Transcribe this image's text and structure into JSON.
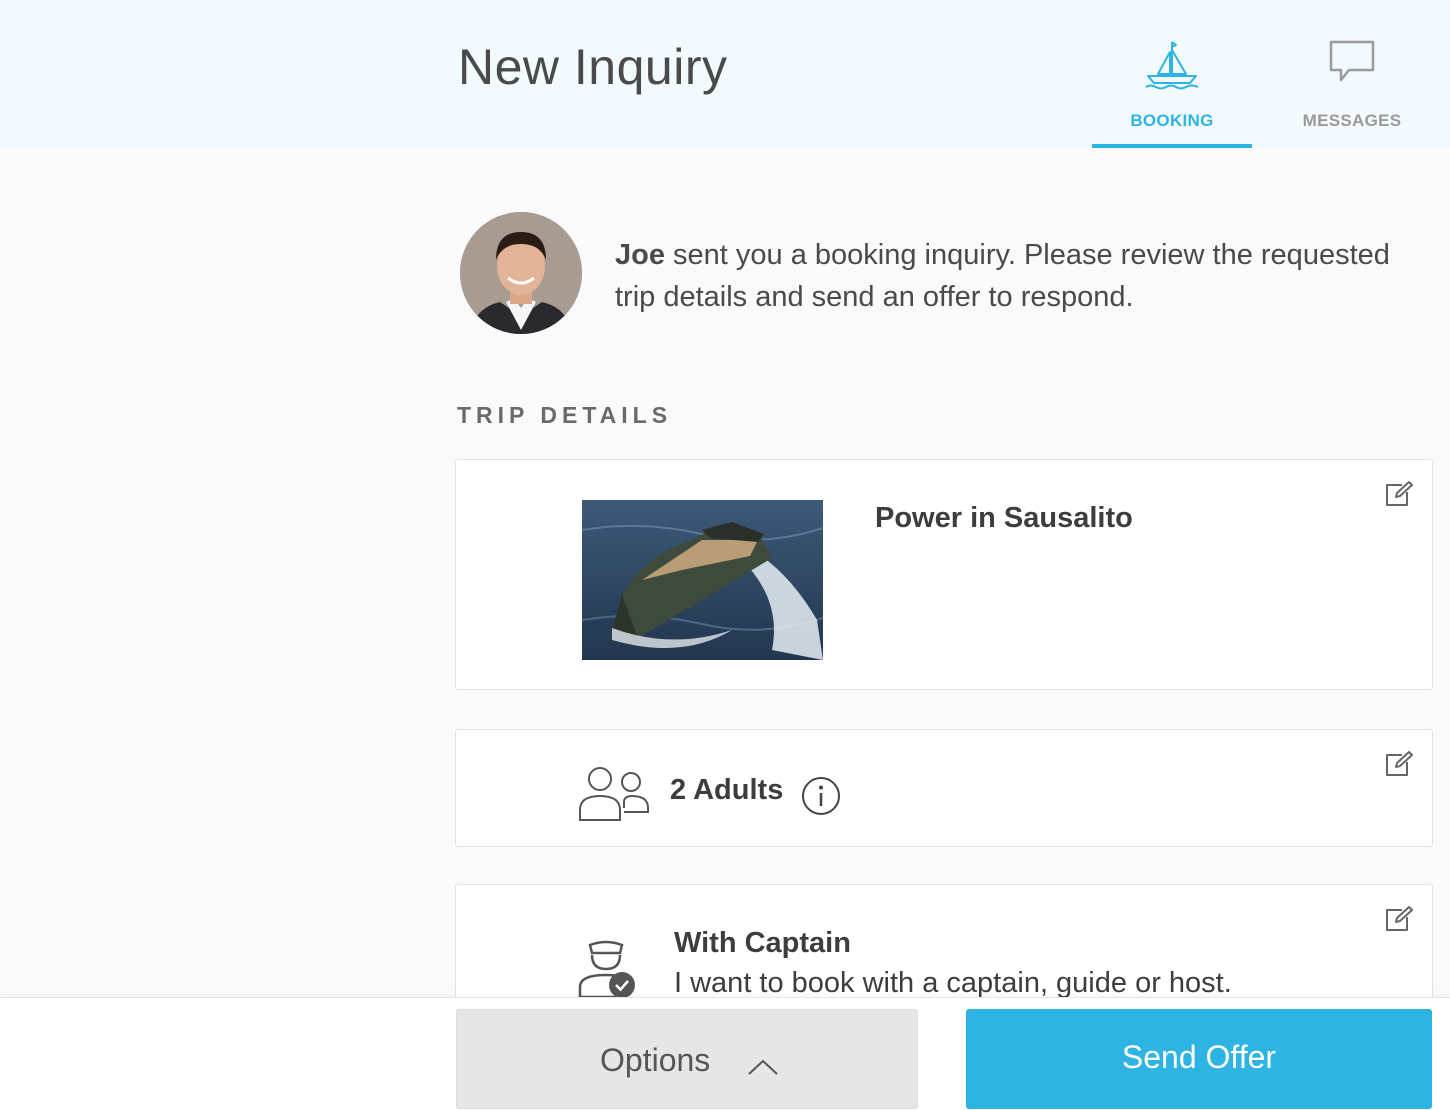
{
  "header": {
    "title": "New Inquiry",
    "tabs": [
      {
        "label": "BOOKING",
        "icon": "sailboat-icon",
        "active": true
      },
      {
        "label": "MESSAGES",
        "icon": "chat-bubble-icon",
        "active": false
      }
    ]
  },
  "intro": {
    "sender": "Joe",
    "message": " sent you a booking inquiry. Please review the requested trip details and send an offer to respond."
  },
  "trip": {
    "section_title": "TRIP DETAILS",
    "boat": {
      "title": "Power in Sausalito"
    },
    "guests": {
      "label": "2 Adults"
    },
    "captain": {
      "title": "With Captain",
      "description": "I want to book with a captain, guide or host."
    }
  },
  "footer": {
    "options_label": "Options",
    "send_label": "Send Offer"
  },
  "colors": {
    "accent": "#2eb4e3",
    "inactive_tab": "#9a9a9a",
    "header_bg": "#f3fafd"
  }
}
